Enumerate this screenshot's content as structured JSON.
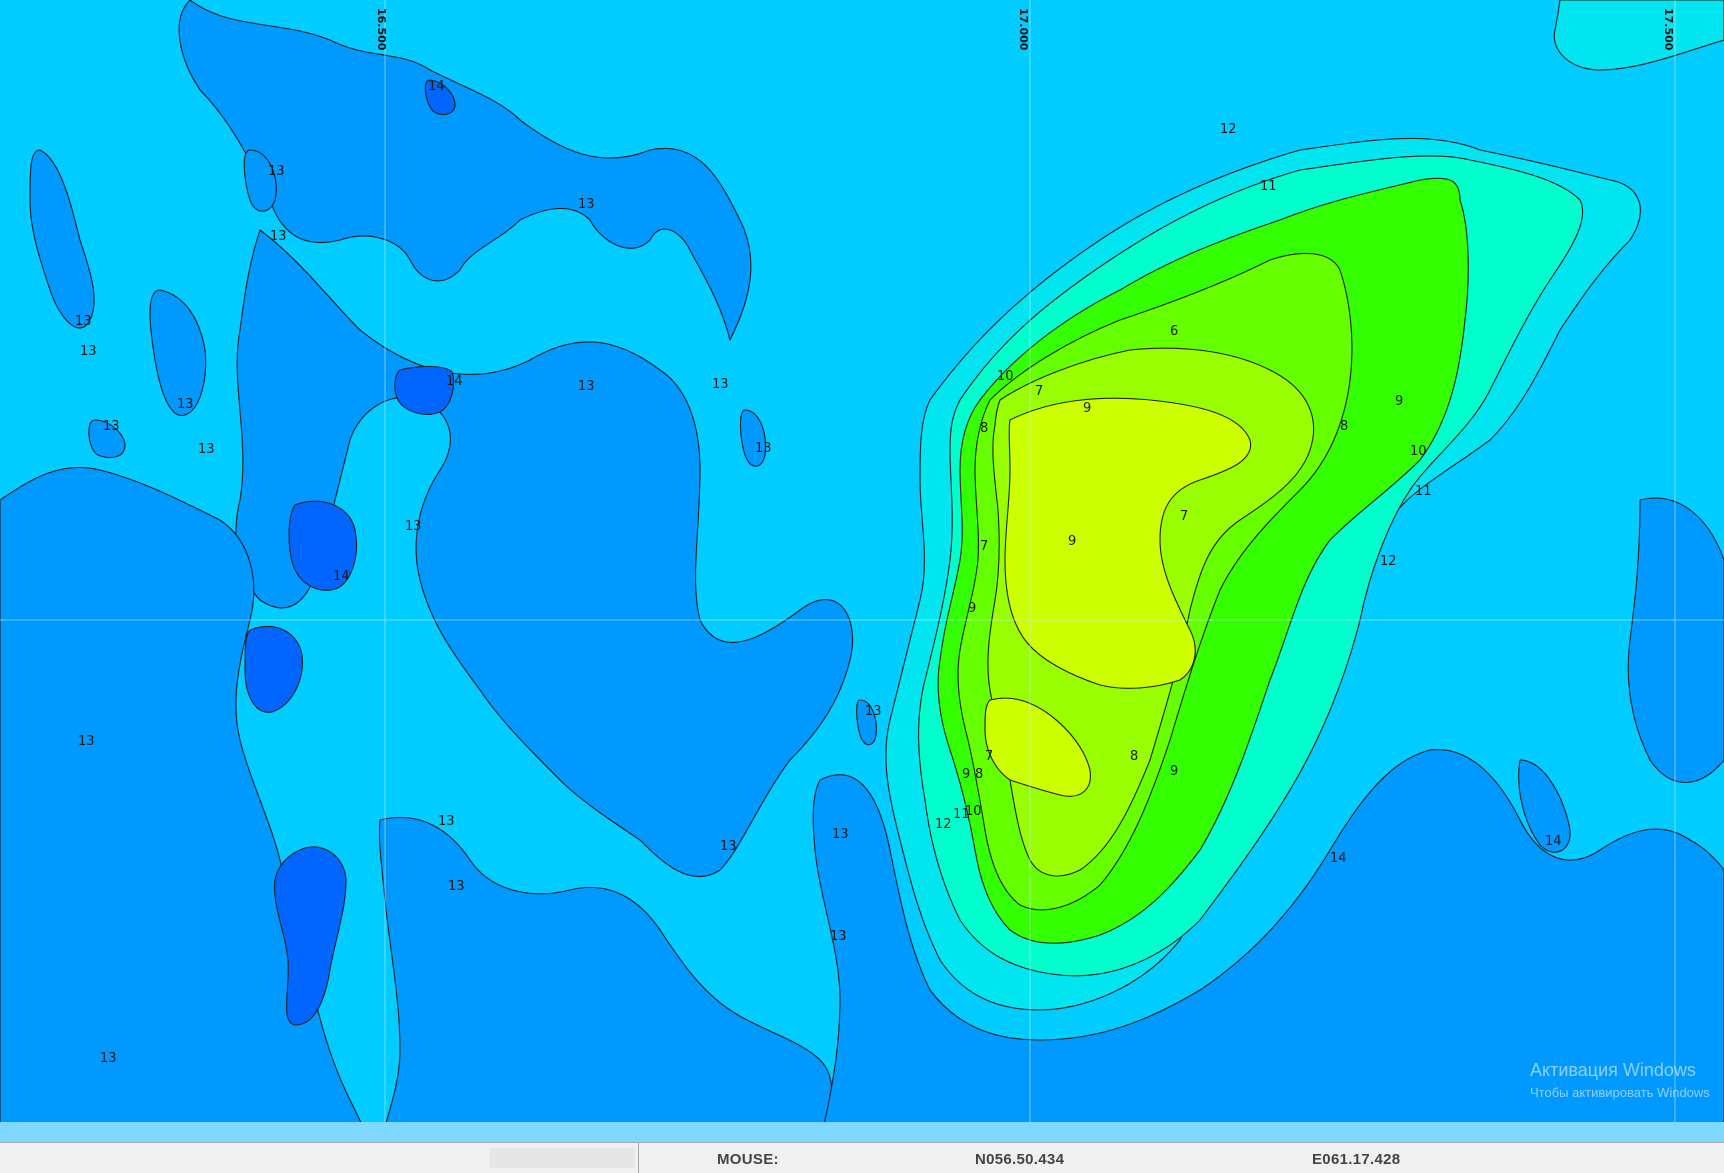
{
  "map": {
    "grid_labels": [
      "16.500",
      "17.000",
      "17.500"
    ],
    "contour_labels": [
      "6",
      "7",
      "7",
      "7",
      "7",
      "8",
      "8",
      "8",
      "8",
      "9",
      "9",
      "9",
      "9",
      "9",
      "9",
      "10",
      "10",
      "10",
      "11",
      "11",
      "11",
      "12",
      "12",
      "12",
      "13",
      "13",
      "13",
      "13",
      "13",
      "13",
      "13",
      "13",
      "13",
      "13",
      "13",
      "13",
      "13",
      "13",
      "13",
      "13",
      "13",
      "13",
      "13",
      "13",
      "14",
      "14",
      "14",
      "14",
      "14"
    ],
    "colors": {
      "level_14": "#0066ff",
      "level_13": "#0099ff",
      "level_12": "#00ccff",
      "level_11": "#00e5f0",
      "level_10": "#00ffcc",
      "level_9": "#33ff00",
      "level_8": "#66ff00",
      "level_7": "#99ff00",
      "level_6": "#ccff00",
      "bottom_band": "#7fd8ff"
    }
  },
  "statusbar": {
    "mouse_label": "MOUSE:",
    "latitude": "N056.50.434",
    "longitude": "E061.17.428"
  },
  "watermark": {
    "line1": "Активация Windows",
    "line2": "Чтобы активировать Windows"
  }
}
